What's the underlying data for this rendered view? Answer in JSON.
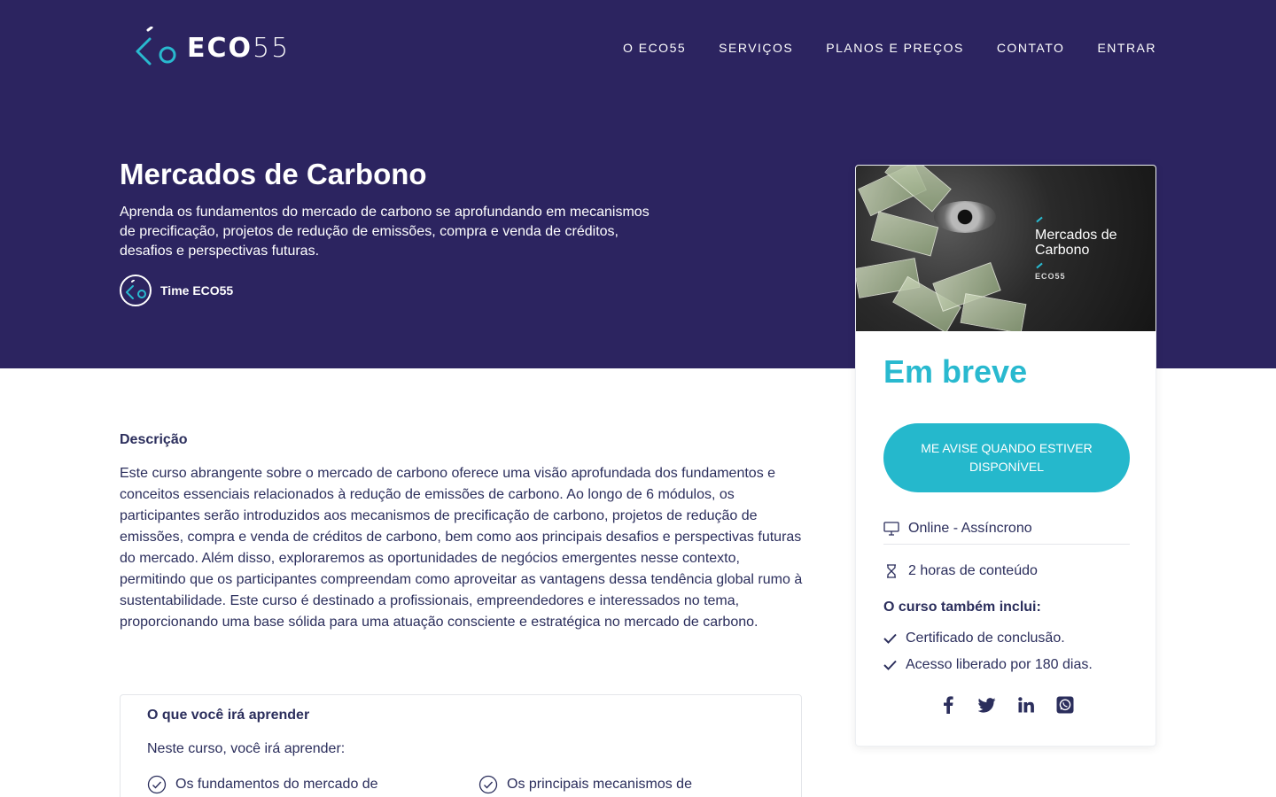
{
  "header": {
    "logo_bold": "ECO",
    "logo_light": "55",
    "nav": [
      "O ECO55",
      "SERVIÇOS",
      "PLANOS E PREÇOS",
      "CONTATO",
      "ENTRAR"
    ]
  },
  "course": {
    "title": "Mercados de Carbono",
    "subtitle": "Aprenda os fundamentos do mercado de carbono se aprofundando em mecanismos de precificação, projetos de redução de emissões, compra e venda de créditos, desafios e perspectivas futuras.",
    "author": "Time ECO55"
  },
  "card": {
    "image_title_line1": "Mercados de",
    "image_title_line2": "Carbono",
    "image_brand": "ECO55",
    "status": "Em breve",
    "notify_button": "ME AVISE QUANDO ESTIVER DISPONÍVEL",
    "features": [
      "Online - Assíncrono",
      "2 horas de conteúdo"
    ],
    "includes_title": "O curso também inclui:",
    "includes": [
      "Certificado de conclusão.",
      "Acesso liberado por 180 dias."
    ]
  },
  "description": {
    "title": "Descrição",
    "text": "Este curso abrangente sobre o mercado de carbono oferece uma visão aprofundada dos fundamentos e conceitos essenciais relacionados à redução de emissões de carbono. Ao longo de 6 módulos, os participantes serão introduzidos aos mecanismos de precificação de carbono, projetos de redução de emissões, compra e venda de créditos de carbono, bem como aos principais desafios e perspectivas futuras do mercado. Além disso, exploraremos as oportunidades de negócios emergentes nesse contexto, permitindo que os participantes compreendam como aproveitar as vantagens dessa tendência global rumo à sustentabilidade. Este curso é destinado a profissionais, empreendedores e interessados no tema, proporcionando uma base sólida para uma atuação consciente e estratégica no mercado de carbono."
  },
  "learn": {
    "title": "O que você irá aprender",
    "intro": "Neste curso, você irá aprender:",
    "items": [
      "Os fundamentos do mercado de",
      "Os principais mecanismos de"
    ]
  },
  "colors": {
    "hero_bg": "#2c2460",
    "accent": "#29b9cf",
    "text": "#2b2e5c"
  },
  "icons": [
    "eco55-logo-icon",
    "monitor-icon",
    "hourglass-icon",
    "check-icon",
    "check-circle-icon",
    "facebook-icon",
    "twitter-icon",
    "linkedin-icon",
    "whatsapp-icon"
  ]
}
